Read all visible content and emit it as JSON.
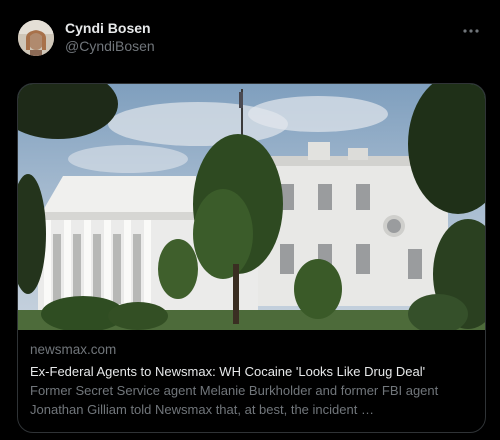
{
  "author": {
    "display_name": "Cyndi Bosen",
    "handle": "@CyndiBosen"
  },
  "card": {
    "domain": "newsmax.com",
    "title": "Ex-Federal Agents to Newsmax: WH Cocaine 'Looks Like Drug Deal'",
    "description": "Former Secret Service agent Melanie Burkholder and former FBI agent Jonathan Gilliam told Newsmax that, at best, the incident …"
  },
  "icons": {
    "more": "more-horizontal-icon"
  },
  "colors": {
    "background": "#000000",
    "primary_text": "#e7e9ea",
    "secondary_text": "#71767b",
    "card_border": "#2f3336"
  }
}
